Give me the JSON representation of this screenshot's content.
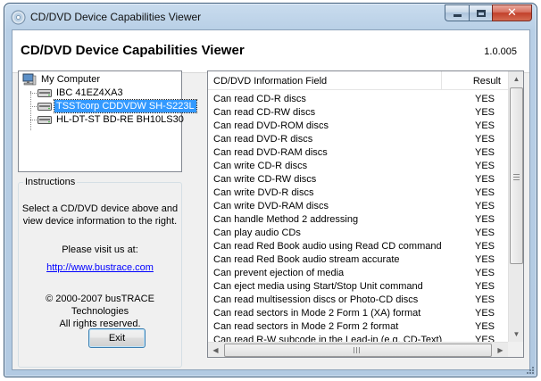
{
  "window": {
    "title": "CD/DVD Device Capabilities Viewer",
    "caption_buttons": {
      "minimize": "minimize-icon",
      "maximize": "maximize-icon",
      "close": "✕"
    }
  },
  "header": {
    "title": "CD/DVD Device Capabilities Viewer",
    "version": "1.0.005"
  },
  "device_tree": {
    "root": "My Computer",
    "devices": [
      {
        "label": "IBC 41EZ4XA3",
        "selected": false
      },
      {
        "label": "TSSTcorp CDDVDW SH-S223L",
        "selected": true
      },
      {
        "label": "HL-DT-ST BD-RE  BH10LS30",
        "selected": false
      }
    ]
  },
  "instructions": {
    "legend": "Instructions",
    "line1": "Select a CD/DVD device above and",
    "line2": "view device information to the right.",
    "visit": "Please visit us at:",
    "url": "http://www.bustrace.com",
    "copyright1": "© 2000-2007 busTRACE Technologies",
    "copyright2": "All rights reserved.",
    "exit_label": "Exit"
  },
  "listview": {
    "columns": {
      "field": "CD/DVD Information Field",
      "result": "Result"
    },
    "rows": [
      {
        "field": "Can read CD-R discs",
        "result": "YES"
      },
      {
        "field": "Can read CD-RW discs",
        "result": "YES"
      },
      {
        "field": "Can read DVD-ROM discs",
        "result": "YES"
      },
      {
        "field": "Can read DVD-R discs",
        "result": "YES"
      },
      {
        "field": "Can read DVD-RAM discs",
        "result": "YES"
      },
      {
        "field": "Can write CD-R discs",
        "result": "YES"
      },
      {
        "field": "Can write CD-RW discs",
        "result": "YES"
      },
      {
        "field": "Can write DVD-R discs",
        "result": "YES"
      },
      {
        "field": "Can write DVD-RAM discs",
        "result": "YES"
      },
      {
        "field": "Can handle Method 2 addressing",
        "result": "YES"
      },
      {
        "field": "Can play audio CDs",
        "result": "YES"
      },
      {
        "field": "Can read Red Book audio using Read CD command",
        "result": "YES"
      },
      {
        "field": "Can read Red Book audio stream accurate",
        "result": "YES"
      },
      {
        "field": "Can prevent ejection of media",
        "result": "YES"
      },
      {
        "field": "Can eject media using Start/Stop Unit command",
        "result": "YES"
      },
      {
        "field": "Can read multisession discs or Photo-CD discs",
        "result": "YES"
      },
      {
        "field": "Can read sectors in Mode 2 Form 1 (XA) format",
        "result": "YES"
      },
      {
        "field": "Can read sectors in Mode 2 Form 2 format",
        "result": "YES"
      },
      {
        "field": "Can read R-W subcode in the Lead-in (e.g. CD-Text)",
        "result": "YES"
      }
    ]
  },
  "colors": {
    "selection": "#3399ff",
    "link": "#0000ff",
    "close_button": "#c2402a"
  }
}
